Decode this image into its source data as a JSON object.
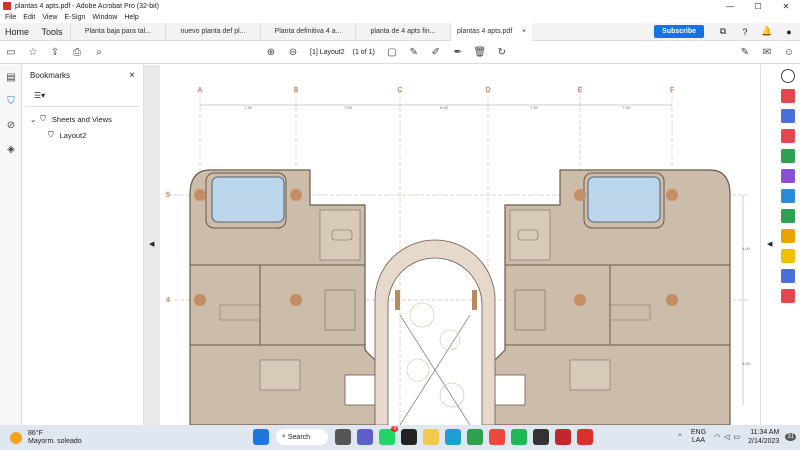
{
  "window": {
    "title": "plantas 4 apts.pdf - Adobe Acrobat Pro (32-bit)"
  },
  "menu": [
    "File",
    "Edit",
    "View",
    "E-Sign",
    "Window",
    "Help"
  ],
  "tabs": {
    "home": "Home",
    "tools": "Tools",
    "docs": [
      "Planta baja para tal...",
      "nuevo planta def pl...",
      "Planta definitiva 4 a...",
      "planta de 4 apts fin...",
      "plantas 4 apts.pdf"
    ],
    "active_close": "×"
  },
  "subscribe": "Subscribe",
  "toolbar": {
    "page_label": "[1] Layout2",
    "page_count": "(1 of 1)"
  },
  "panel": {
    "title": "Bookmarks",
    "close": "×",
    "tree": {
      "root": "Sheets and Views",
      "child": "Layout2"
    }
  },
  "plan": {
    "grid_labels": [
      "A",
      "B",
      "C",
      "D",
      "E",
      "F"
    ],
    "row_labels": [
      "5",
      "4"
    ],
    "dims": [
      "7.30",
      "7.00",
      "6.00",
      "7.30",
      "7.00"
    ],
    "side_dims": [
      "6.00",
      "6.00"
    ]
  },
  "taskbar": {
    "temp": "86°F",
    "weather": "Mayorm. soleado",
    "search": "Search",
    "badge": "4",
    "lang1": "ENG",
    "lang2": "LAA",
    "time": "11:34 AM",
    "date": "2/14/2023",
    "notif": "31"
  },
  "colors": {
    "accent": "#1473e6",
    "pdf_red": "#d9302a",
    "plan_fill": "#ccbcaa",
    "pool": "#bcd7ec"
  }
}
